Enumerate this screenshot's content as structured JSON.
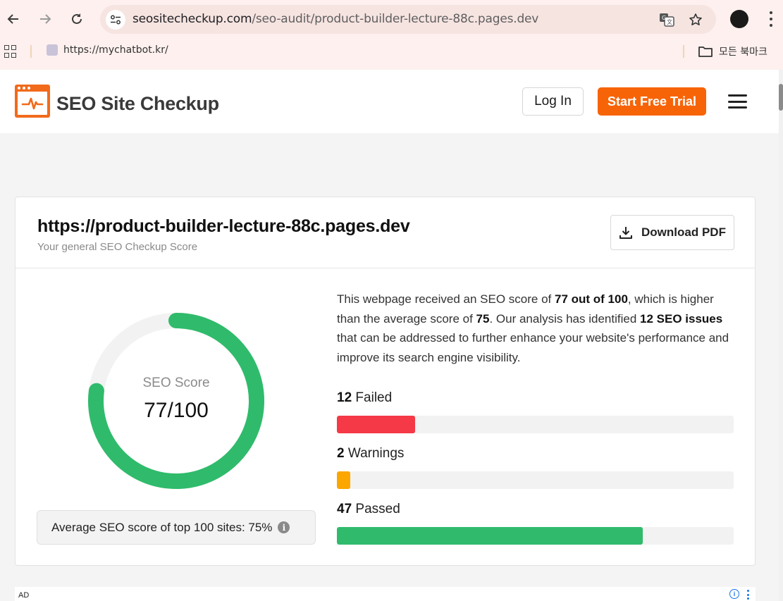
{
  "browser": {
    "url_host": "seositecheckup.com",
    "url_path": "/seo-audit/product-builder-lecture-88c.pages.dev",
    "bookmark": "https://mychatbot.kr/",
    "bookmarks_folder": "모든 북마크"
  },
  "header": {
    "logo_text": "SEO Site Checkup",
    "login_label": "Log In",
    "trial_label": "Start Free Trial",
    "brand_color": "#f76407"
  },
  "report": {
    "site_url": "https://product-builder-lecture-88c.pages.dev",
    "subtitle": "Your general SEO Checkup Score",
    "download_label": "Download PDF",
    "gauge_label": "SEO Score",
    "score_text": "77/100",
    "score": 77,
    "score_max": 100,
    "avg_text": "Average SEO score of top 100 sites: 75%",
    "summary": {
      "p1": "This webpage received an SEO score of ",
      "b1": "77 out of 100",
      "p2": ", which is higher than the average score of ",
      "b2": "75",
      "p3": ". Our analysis has identified ",
      "b3": "12 SEO issues",
      "p4": " that can be addressed to further enhance your website's performance and improve its search engine visibility."
    },
    "stats": [
      {
        "count": "12",
        "label": "Failed",
        "fraction": 0.197,
        "color": "#f53946"
      },
      {
        "count": "2",
        "label": "Warnings",
        "fraction": 0.033,
        "color": "#fba601"
      },
      {
        "count": "47",
        "label": "Passed",
        "fraction": 0.77,
        "color": "#2fbb6b"
      }
    ],
    "gauge_color": "#2fbb6b",
    "track_color": "#f2f2f2"
  },
  "ad": {
    "label": "AD",
    "info_glyph": "i"
  }
}
